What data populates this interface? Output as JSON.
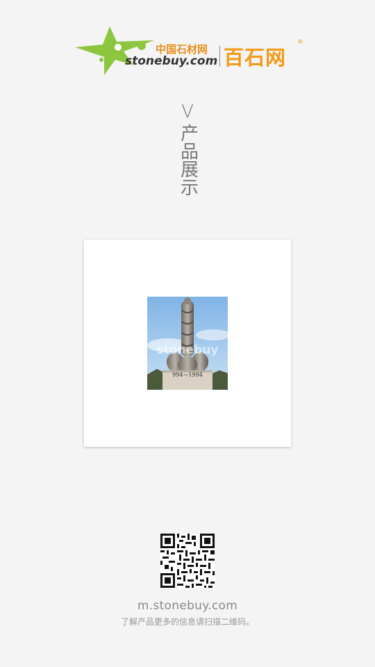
{
  "header": {
    "logo_cn_small": "中国石材网",
    "logo_en": "stonebuy.com",
    "logo_cn_big": "百石网",
    "logo_reg": "®"
  },
  "section": {
    "mark": "V",
    "title": "产品展示"
  },
  "product": {
    "image_icon": "stone-sculpture-photo",
    "watermark": "stonebuy",
    "caption": "994—1994"
  },
  "footer": {
    "qr_icon": "qr-code-icon",
    "url": "m.stonebuy.com",
    "note": "了解产品更多的信息请扫描二维码。"
  },
  "colors": {
    "background": "#f4f4f4",
    "brand_green": "#8cc63f",
    "brand_orange": "#f39a1a"
  }
}
